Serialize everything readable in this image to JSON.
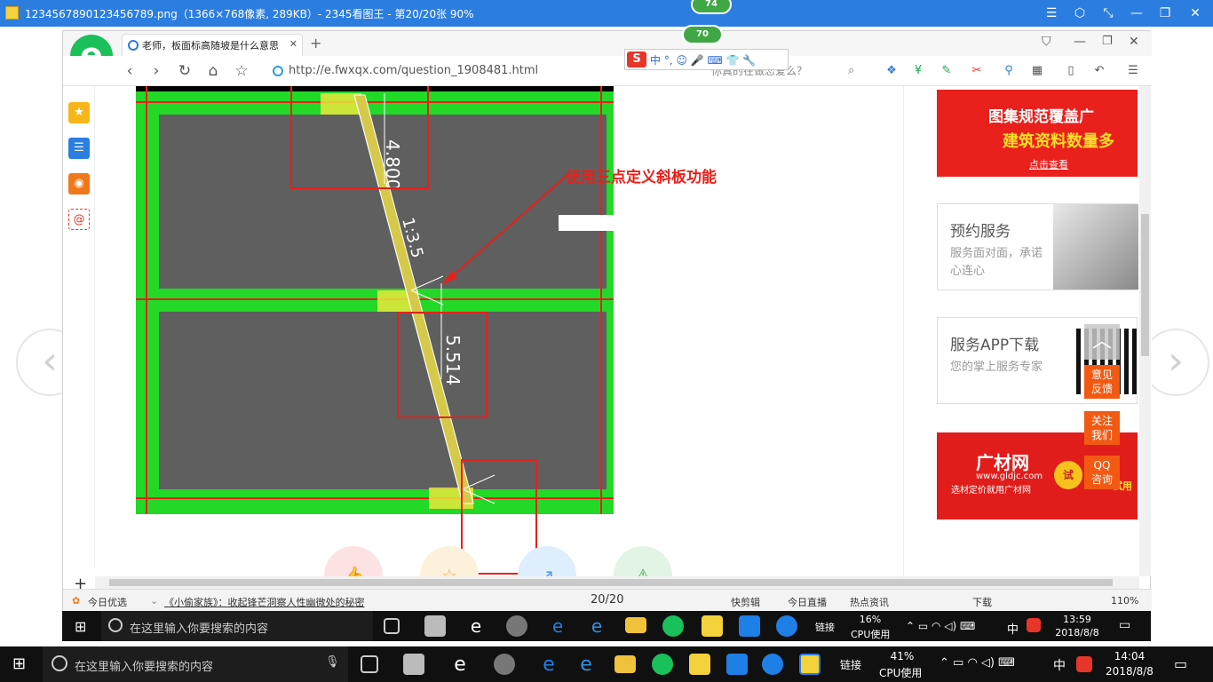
{
  "viewer": {
    "title": "1234567890123456789.png（1366×768像素, 289KB）- 2345看图王 - 第20/20张 90%",
    "controls": [
      "☰",
      "⬡",
      "⤡",
      "—",
      "❐",
      "✕"
    ],
    "badge": "74"
  },
  "browser": {
    "tab_title": "老师，板面标高随坡是什么意思",
    "url": "http://e.fwxqx.com/question_1908481.html",
    "search_placeholder": "你真的在做恋爱么？",
    "badge": "70",
    "sogou_label": "中 °, ☺ 🎤 ⌨ 👕 🔧"
  },
  "content": {
    "annotation": "使用三点定义斜板功能",
    "cad_labels": [
      "4.800",
      "1:3.5",
      "5.514"
    ]
  },
  "ads": {
    "ad1": {
      "line1": "图集规范覆盖广",
      "line2": "建筑资料数量多",
      "link": "点击查看"
    },
    "ad2": {
      "title": "预约服务",
      "sub": "服务面对面，承诺心连心"
    },
    "ad3": {
      "title": "服务APP下载",
      "sub": "您的掌上服务专家"
    },
    "ad4": {
      "title": "广材网",
      "sub": "www.gldjc.com",
      "tagline": "选材定价就用广材网",
      "tryout": "试",
      "tail": "试用"
    }
  },
  "float_buttons": [
    {
      "label": "意见\n反馈"
    },
    {
      "label": "关注\n我们"
    },
    {
      "label": "QQ\n咨询"
    }
  ],
  "statusbar": {
    "left": "今日优选",
    "news": "《小偷家族》：收起锋芒洞察人性幽微处的秘密",
    "page": "20/20",
    "items": [
      "快剪辑",
      "今日直播",
      "热点资讯",
      "下载"
    ],
    "zoom": "110%"
  },
  "inner_taskbar": {
    "search": "在这里输入你要搜索的内容",
    "link_label": "链接",
    "cpu_value": "16%",
    "cpu_label": "CPU使用",
    "ime": "中",
    "time": "13:59",
    "date": "2018/8/8"
  },
  "outer_taskbar": {
    "search": "在这里输入你要搜索的内容",
    "link_label": "链接",
    "cpu_value": "41%",
    "cpu_label": "CPU使用",
    "ime": "中",
    "time": "14:04",
    "date": "2018/8/8"
  },
  "colors": {
    "accent": "#2b7de0",
    "cad_green": "#22d928",
    "cad_slab": "#5f5f5f",
    "annotation_red": "#e8201a"
  }
}
